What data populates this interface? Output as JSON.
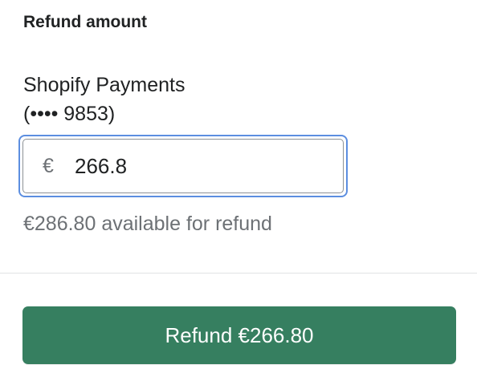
{
  "refund": {
    "section_title": "Refund amount",
    "payment_method_line1": "Shopify Payments",
    "payment_method_line2": "(•••• 9853)",
    "currency_symbol": "€",
    "amount_value": "266.8",
    "available_text": "€286.80 available for refund",
    "button_label": "Refund €266.80"
  },
  "colors": {
    "accent_focus": "#5c8ee0",
    "button_background": "#367f60",
    "muted_text": "#6d7175"
  }
}
